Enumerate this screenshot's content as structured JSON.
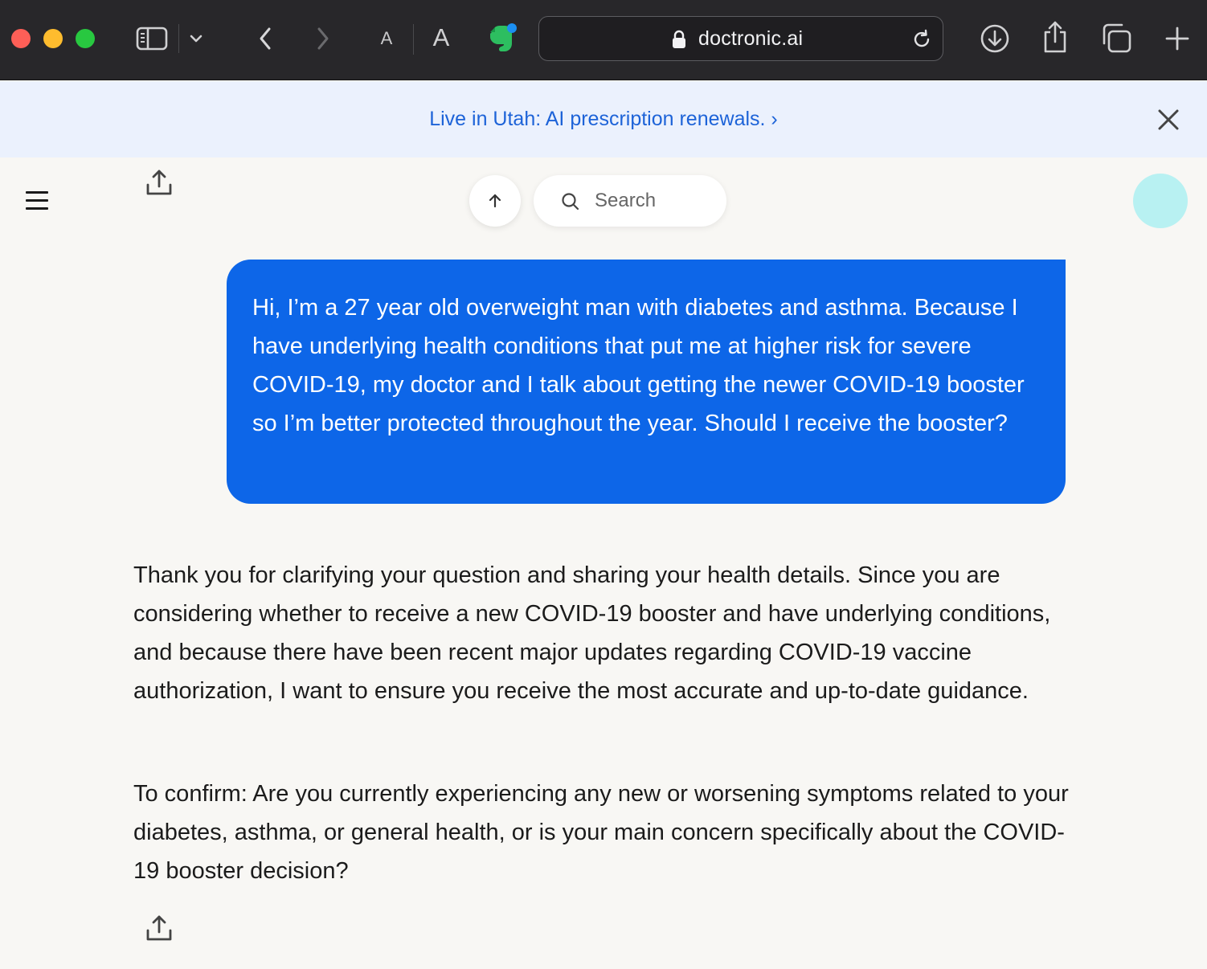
{
  "browser": {
    "url": "doctronic.ai",
    "font_small_label": "A",
    "font_large_label": "A",
    "icons": [
      "sidebar-icon",
      "chevron-down-icon",
      "back-icon",
      "forward-icon",
      "evernote-icon",
      "lock-icon",
      "reload-icon",
      "download-icon",
      "share-icon",
      "tabs-icon",
      "new-tab-icon"
    ]
  },
  "banner": {
    "text": "Live in Utah: AI prescription renewals. ›",
    "background": "#ebf1fd",
    "link_color": "#1d63d8"
  },
  "header": {
    "search_placeholder": "Search",
    "avatar_color": "#b8f1f2"
  },
  "conversation": {
    "user_message": "Hi, I’m a 27 year old overweight man with diabetes and asthma. Because I have underlying health conditions that put me at higher risk for severe COVID-19, my doctor and I talk about getting the newer COVID-19 booster so I’m better protected throughout the year. Should I receive the booster?",
    "user_bubble_color": "#0d66e8",
    "assistant_paragraphs": [
      "Thank you for clarifying your question and sharing your health details. Since you are considering whether to receive a new COVID-19 booster and have underlying conditions, and because there have been recent major updates regarding COVID-19 vaccine authorization, I want to ensure you receive the most accurate and up-to-date guidance.",
      "To confirm: Are you currently experiencing any new or worsening symptoms related to your diabetes, asthma, or general health, or is your main concern specifically about the COVID-19 booster decision?"
    ]
  }
}
